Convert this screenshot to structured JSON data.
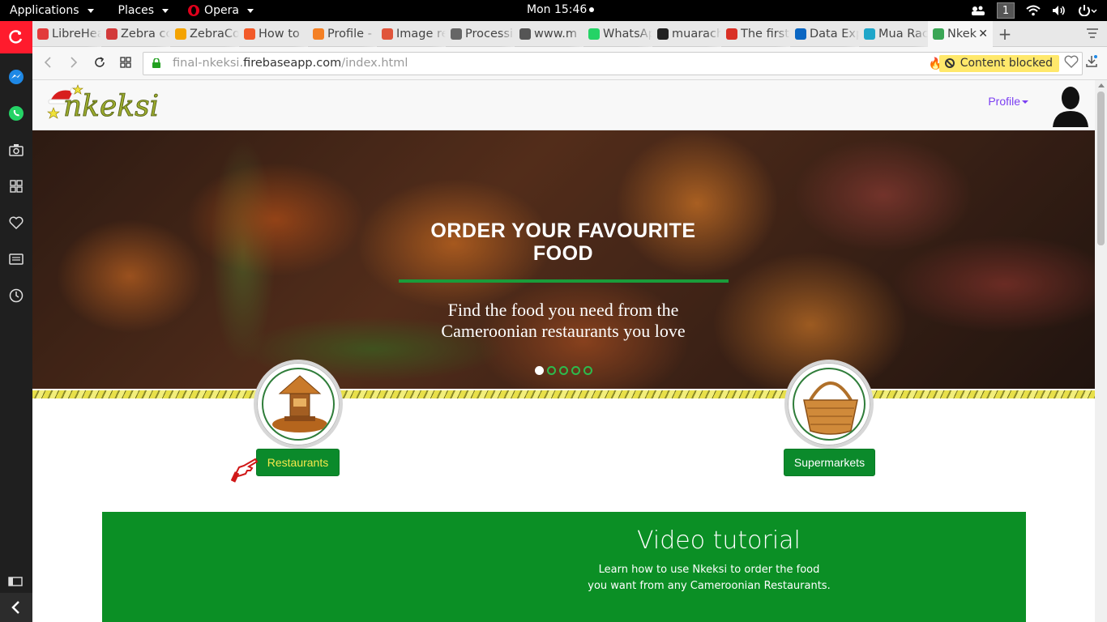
{
  "topbar": {
    "applications": "Applications",
    "places": "Places",
    "app_name": "Opera",
    "clock": "Mon 15:46",
    "workspace": "1"
  },
  "tabs": [
    {
      "title": "LibreHea",
      "favicon_color": "#e23b3b"
    },
    {
      "title": "Zebra cc",
      "favicon_color": "#d23a3a"
    },
    {
      "title": "ZebraCo",
      "favicon_color": "#f4a300"
    },
    {
      "title": "How to",
      "favicon_color": "#f25a29"
    },
    {
      "title": "Profile -",
      "favicon_color": "#f48024"
    },
    {
      "title": "Image re",
      "favicon_color": "#e0553b"
    },
    {
      "title": "Processi",
      "favicon_color": "#666666"
    },
    {
      "title": "www.m",
      "favicon_color": "#555555"
    },
    {
      "title": "WhatsAp",
      "favicon_color": "#25d366"
    },
    {
      "title": "muarach",
      "favicon_color": "#222222"
    },
    {
      "title": "The first",
      "favicon_color": "#d93025"
    },
    {
      "title": "Data Exp",
      "favicon_color": "#0a66c2"
    },
    {
      "title": "Mua Rac",
      "favicon_color": "#1fa6c9"
    },
    {
      "title": "Nkek",
      "favicon_color": "#3aa655"
    }
  ],
  "address": {
    "prefix": "final-nkeksi.",
    "host": "firebaseapp.com",
    "path": "/index.html",
    "content_blocked": "Content blocked"
  },
  "site": {
    "logo_text": "nkeksi",
    "profile_label": "Profile",
    "hero_title": "ORDER YOUR FAVOURITE FOOD",
    "hero_subtitle": "Find the food you need from the Cameroonian restaurants you love",
    "slides_total": 5,
    "slide_active": 1,
    "categories": {
      "restaurants": "Restaurants",
      "supermarkets": "Supermarkets"
    },
    "video_title": "Video tutorial",
    "video_subtitle_line1": "Learn how to use Nkeksi to order the food",
    "video_subtitle_line2": "you want from any Cameroonian Restaurants."
  },
  "colors": {
    "brand_green": "#0b8a2b",
    "profile_link": "#7b3ff2",
    "opera_red": "#ff1b2d",
    "blocked_badge": "#ffe86b"
  }
}
